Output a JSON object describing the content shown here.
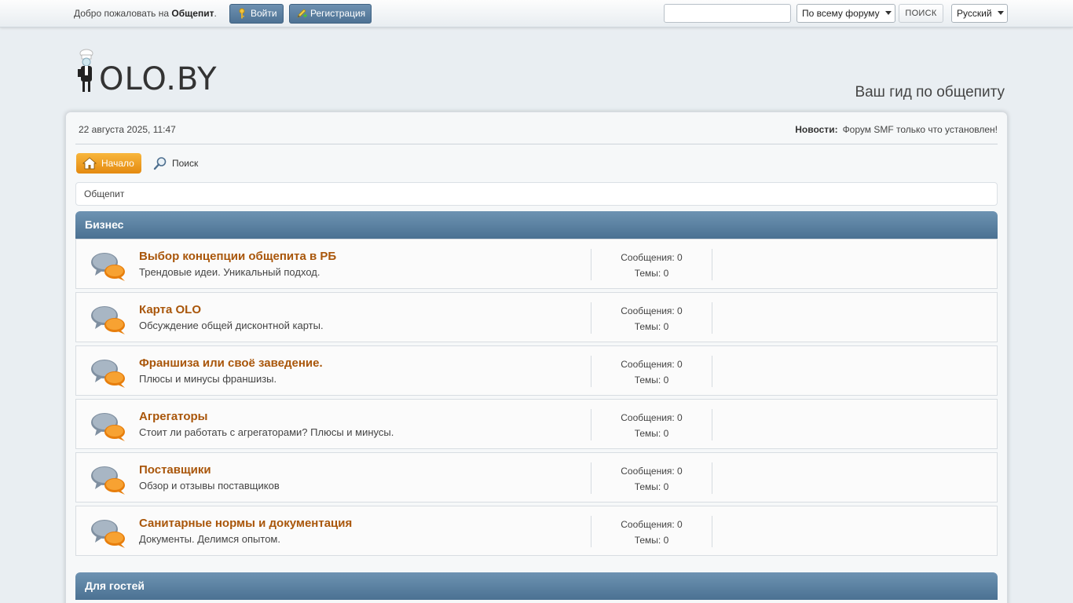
{
  "topbar": {
    "welcome_prefix": "Добро пожаловать на ",
    "welcome_site": "Общепит",
    "welcome_suffix": ".",
    "login_label": "Войти",
    "register_label": "Регистрация",
    "search_value": "",
    "search_scope": "По всему форуму",
    "search_button": "ПОИСК",
    "language": "Русский"
  },
  "header": {
    "logo_text": "OLO.BY",
    "slogan": "Ваш гид по общепиту"
  },
  "info": {
    "date": "22 августа 2025, 11:47",
    "news_label": "Новости:",
    "news_text": "Форум SMF только что установлен!"
  },
  "nav": {
    "home": "Начало",
    "search": "Поиск"
  },
  "breadcrumb": "Общепит",
  "categories": [
    {
      "title": "Бизнес",
      "boards": [
        {
          "name": "Выбор концепции общепита в РБ",
          "desc": "Трендовые идеи. Уникальный подход.",
          "posts": "Сообщения: 0",
          "topics": "Темы: 0"
        },
        {
          "name": "Карта OLO",
          "desc": "Обсуждение общей дисконтной карты.",
          "posts": "Сообщения: 0",
          "topics": "Темы: 0"
        },
        {
          "name": "Франшиза или своё заведение.",
          "desc": "Плюсы и минусы франшизы.",
          "posts": "Сообщения: 0",
          "topics": "Темы: 0"
        },
        {
          "name": "Агрегаторы",
          "desc": "Стоит ли работать с агрегаторами? Плюсы и минусы.",
          "posts": "Сообщения: 0",
          "topics": "Темы: 0"
        },
        {
          "name": "Поставщики",
          "desc": "Обзор и отзывы поставщиков",
          "posts": "Сообщения: 0",
          "topics": "Темы: 0"
        },
        {
          "name": "Санитарные нормы и документация",
          "desc": "Документы. Делимся опытом.",
          "posts": "Сообщения: 0",
          "topics": "Темы: 0"
        }
      ]
    },
    {
      "title": "Для гостей",
      "boards": []
    }
  ],
  "colors": {
    "accent_orange": "#e48a10",
    "category_blue": "#4b7192",
    "board_link": "#a9560a"
  }
}
